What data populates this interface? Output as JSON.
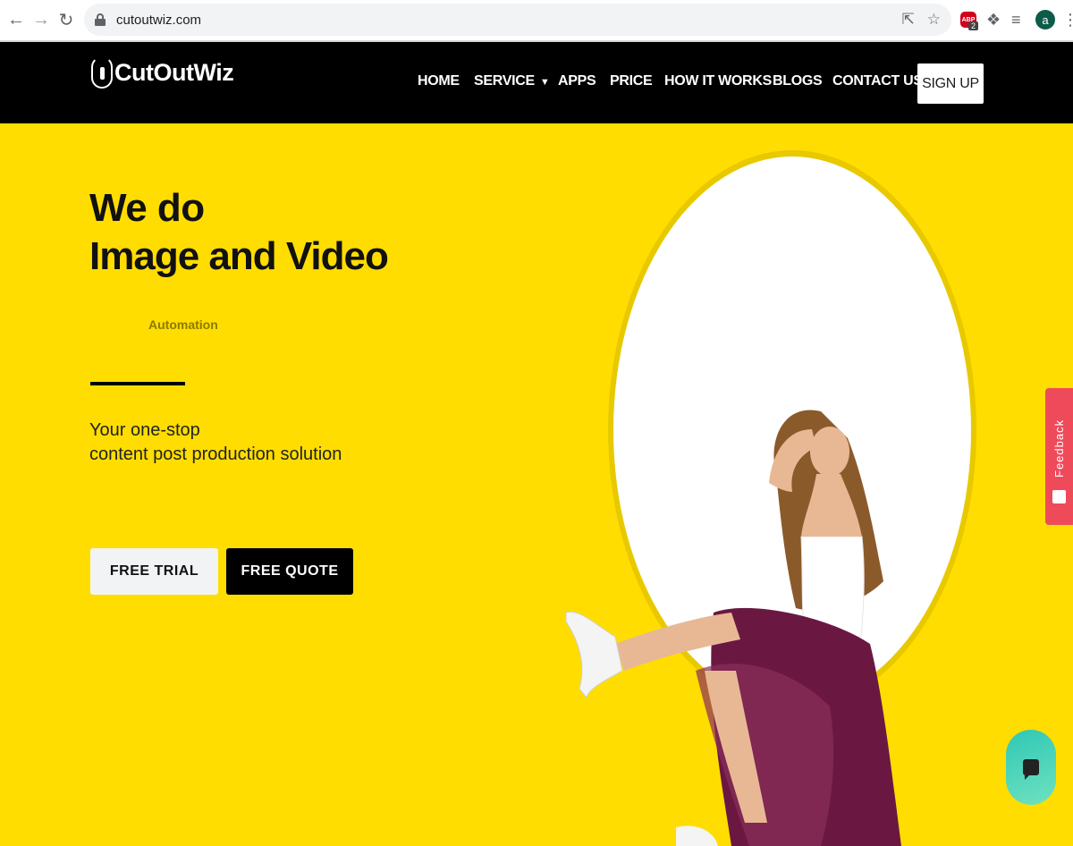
{
  "browser": {
    "url": "cutoutwiz.com",
    "adblock_count": "2",
    "profile_initial": "a"
  },
  "site": {
    "logo_text": "CutOutWiz",
    "menu": [
      {
        "label": "HOME"
      },
      {
        "label": "SERVICE"
      },
      {
        "label": "APPS"
      },
      {
        "label": "PRICE"
      },
      {
        "label": "HOW IT WORKS"
      },
      {
        "label": "BLOGS"
      },
      {
        "label": "CONTACT US"
      }
    ],
    "signup_label": "SIGN UP"
  },
  "hero": {
    "line1": "We do",
    "line2": "Image and Video",
    "sub": "Automation",
    "tagline_1": "Your one-stop",
    "tagline_2": "content post production solution",
    "free_trial": "FREE TRIAL",
    "free_quote": "FREE QUOTE"
  },
  "widgets": {
    "feedback_label": "Feedback"
  },
  "colors": {
    "hero_bg": "#ffdd00",
    "header_bg": "#000000",
    "feedback_bg": "#ef4a5a",
    "chat_gradient_start": "#2fc7b5"
  }
}
